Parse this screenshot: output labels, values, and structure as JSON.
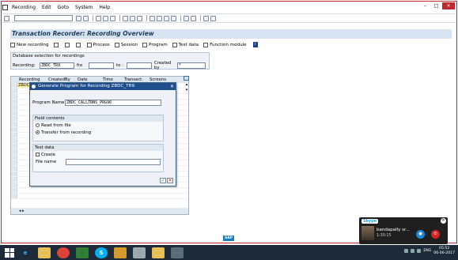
{
  "menu": {
    "items": [
      "Recording",
      "Edit",
      "Goto",
      "System",
      "Help"
    ]
  },
  "window_controls": [
    "–",
    "□",
    "✕"
  ],
  "screen": {
    "title": "Transaction Recorder: Recording Overview"
  },
  "app_toolbar": {
    "new_recording": "New recording",
    "process": "Process",
    "session": "Session",
    "program": "Program",
    "test_data": "Test data",
    "function_module": "Function module",
    "info": "i"
  },
  "selection": {
    "header": "Database selection for recordings",
    "recording_label": "Recording:",
    "recording_value": "ZBDC_TR9",
    "from_label": "fro",
    "to_label": "to :",
    "created_by_label": "Created by",
    "created_by_value": "*"
  },
  "grid": {
    "columns": [
      "Recording",
      "CreatedBy",
      "Date",
      "Time",
      "Transact.",
      "Screens"
    ],
    "first_cell": "ZBDC"
  },
  "dialog": {
    "title": "Generate Program for Recording ZBDC_TR9",
    "program_name_label": "Program Name",
    "program_name_value": "ZBDC_CALLTRNS_PRG96",
    "field_contents_header": "Field contents",
    "read_from_file": "Read from file",
    "transfer_from_recording": "Transfer from recording",
    "test_data_header": "Test data",
    "create_label": "Create",
    "file_name_label": "File name",
    "file_name_value": "",
    "selected_option": "transfer_from_recording"
  },
  "sap_logo": "SAP",
  "skype": {
    "badge": "Skype",
    "caller": "bandapally sr...",
    "duration": "1:30:15"
  },
  "taskbar": {
    "tray_lang": "ENG",
    "time": "05:52",
    "date": "06-06-2017"
  },
  "colors": {
    "frame": "#c1272d",
    "title_bg": "#d6e4f2",
    "dialog_title_bg": "#1f4e8c",
    "selected_cell": "#fff2a8",
    "taskbar_bg": "#1c2a3a"
  }
}
